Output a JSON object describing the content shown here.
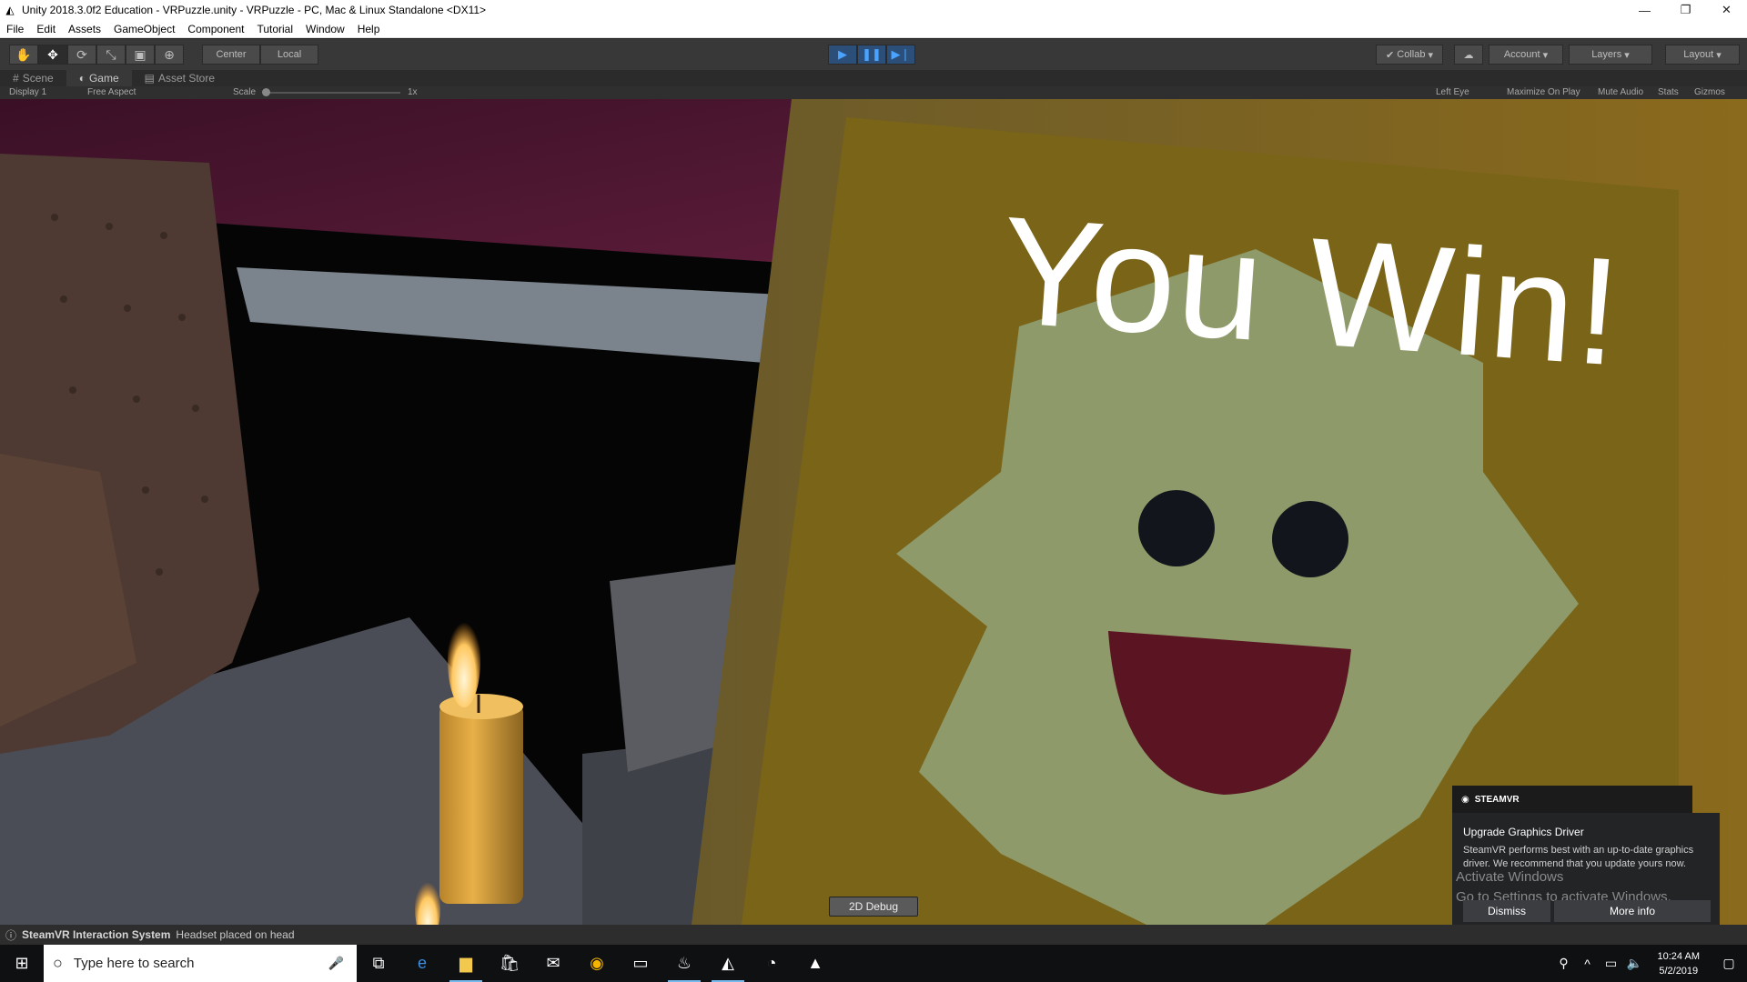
{
  "window": {
    "title": "Unity 2018.3.0f2 Education - VRPuzzle.unity - VRPuzzle - PC, Mac & Linux Standalone <DX11>",
    "minimize": "—",
    "restore": "❐",
    "close": "✕"
  },
  "menu": [
    "File",
    "Edit",
    "Assets",
    "GameObject",
    "Component",
    "Tutorial",
    "Window",
    "Help"
  ],
  "toolbar": {
    "pivot_center": "Center",
    "pivot_local": "Local",
    "collab": "Collab",
    "account": "Account",
    "layers": "Layers",
    "layout": "Layout"
  },
  "tabs": [
    "Scene",
    "Game",
    "Asset Store"
  ],
  "gamebar": {
    "display": "Display 1",
    "aspect": "Free Aspect",
    "scale_label": "Scale",
    "scale_value": "1x",
    "eye": "Left Eye",
    "maximize": "Maximize On Play",
    "mute": "Mute Audio",
    "stats": "Stats",
    "gizmos": "Gizmos"
  },
  "game": {
    "win_text": "You Win!",
    "debug_button": "2D Debug"
  },
  "notification": {
    "brand": "STEAMVR",
    "title": "Upgrade Graphics Driver",
    "text": "SteamVR performs best with an up-to-date graphics driver. We recommend that you update yours now.",
    "activate_line1": "Activate Windows",
    "activate_line2": "Go to Settings to activate Windows.",
    "dismiss": "Dismiss",
    "more_info": "More info"
  },
  "status": {
    "source": "SteamVR Interaction System",
    "message": "Headset placed on head"
  },
  "taskbar": {
    "search_placeholder": "Type here to search",
    "time": "10:24 AM",
    "date": "5/2/2019"
  },
  "colors": {
    "wall": "#4a1730",
    "frame": "#6b5512",
    "board": "#7a6418",
    "face": "#8e9a6a",
    "mouth": "#5a1422",
    "candle": "#e0a63a",
    "accent": "#4aa3ff"
  }
}
